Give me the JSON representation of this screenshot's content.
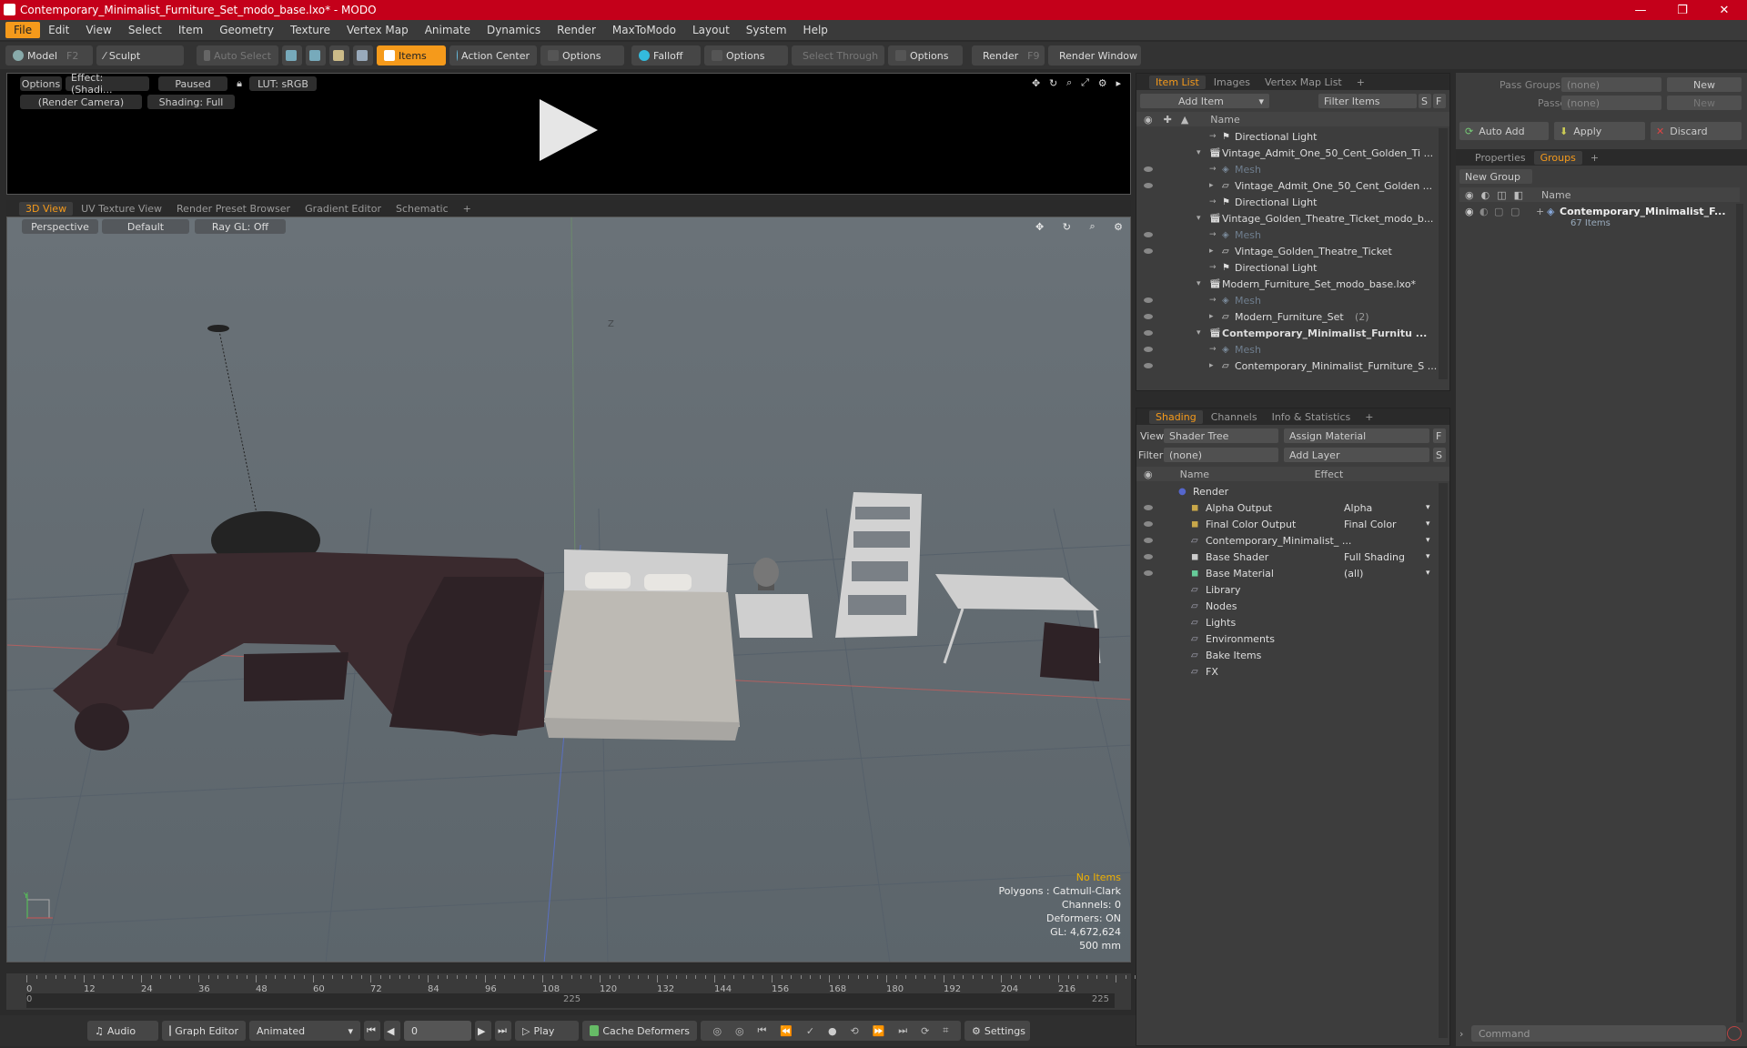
{
  "window": {
    "title": "Contemporary_Minimalist_Furniture_Set_modo_base.lxo* - MODO",
    "minimize": "—",
    "maximize": "❐",
    "close": "✕"
  },
  "menu": [
    "File",
    "Edit",
    "View",
    "Select",
    "Item",
    "Geometry",
    "Texture",
    "Vertex Map",
    "Animate",
    "Dynamics",
    "Render",
    "MaxToModo",
    "Layout",
    "System",
    "Help"
  ],
  "toolbar": {
    "model": "Model",
    "model_key": "F2",
    "sculpt": "Sculpt",
    "auto_select": "Auto Select",
    "items": "Items",
    "action_center": "Action Center",
    "options1": "Options",
    "falloff": "Falloff",
    "options2": "Options",
    "select_through": "Select Through",
    "options3": "Options",
    "render": "Render",
    "render_key": "F9",
    "render_window": "Render Window"
  },
  "preview": {
    "options": "Options",
    "effect": "Effect: (Shadi...",
    "paused": "Paused",
    "lut": "LUT: sRGB",
    "camera": "(Render Camera)",
    "shading": "Shading: Full"
  },
  "view_tabs": [
    "3D View",
    "UV Texture View",
    "Render Preset Browser",
    "Gradient Editor",
    "Schematic",
    "+"
  ],
  "viewport": {
    "perspective": "Perspective",
    "default": "Default",
    "raygl": "Ray GL: Off",
    "info": {
      "no_items": "No Items",
      "polygons": "Polygons : Catmull-Clark",
      "channels": "Channels: 0",
      "deformers": "Deformers: ON",
      "gl": "GL: 4,672,624",
      "scale": "500 mm"
    },
    "axis_z": "Z",
    "axis_y": "Y"
  },
  "timeline": {
    "ticks": [
      "0",
      "12",
      "24",
      "36",
      "48",
      "60",
      "72",
      "84",
      "96",
      "108",
      "120",
      "132",
      "144",
      "156",
      "168",
      "180",
      "192",
      "204",
      "216"
    ],
    "start": "0",
    "mid": "225",
    "end": "225"
  },
  "transport": {
    "audio": "Audio",
    "graph_editor": "Graph Editor",
    "animated": "Animated",
    "frame": "0",
    "play": "Play",
    "cache": "Cache Deformers",
    "settings": "Settings"
  },
  "item_list": {
    "tabs": [
      "Item List",
      "Images",
      "Vertex Map List",
      "+"
    ],
    "add_item": "Add Item",
    "filter_items": "Filter Items",
    "s": "S",
    "f": "F",
    "name_header": "Name",
    "rows": [
      {
        "indent": 1,
        "label": "Directional Light",
        "kind": "light"
      },
      {
        "indent": 0,
        "label": "Vintage_Admit_One_50_Cent_Golden_Ti ...",
        "kind": "scene"
      },
      {
        "indent": 1,
        "label": "Mesh",
        "kind": "mesh"
      },
      {
        "indent": 1,
        "label": "Vintage_Admit_One_50_Cent_Golden ...",
        "kind": "group"
      },
      {
        "indent": 1,
        "label": "Directional Light",
        "kind": "light"
      },
      {
        "indent": 0,
        "label": "Vintage_Golden_Theatre_Ticket_modo_b...",
        "kind": "scene"
      },
      {
        "indent": 1,
        "label": "Mesh",
        "kind": "mesh"
      },
      {
        "indent": 1,
        "label": "Vintage_Golden_Theatre_Ticket",
        "kind": "group"
      },
      {
        "indent": 1,
        "label": "Directional Light",
        "kind": "light"
      },
      {
        "indent": 0,
        "label": "Modern_Furniture_Set_modo_base.lxo*",
        "kind": "scene"
      },
      {
        "indent": 1,
        "label": "Mesh",
        "kind": "mesh"
      },
      {
        "indent": 1,
        "label": "Modern_Furniture_Set",
        "kind": "group",
        "count": "(2)"
      },
      {
        "indent": 0,
        "label": "Contemporary_Minimalist_Furnitu ...",
        "kind": "scene",
        "bold": true
      },
      {
        "indent": 1,
        "label": "Mesh",
        "kind": "mesh"
      },
      {
        "indent": 1,
        "label": "Contemporary_Minimalist_Furniture_S ...",
        "kind": "group"
      }
    ]
  },
  "shading": {
    "tabs": [
      "Shading",
      "Channels",
      "Info & Statistics",
      "+"
    ],
    "view_label": "View",
    "view_value": "Shader Tree",
    "assign_material": "Assign Material",
    "f": "F",
    "filter_label": "Filter",
    "filter_value": "(none)",
    "add_layer": "Add Layer",
    "s": "S",
    "name_header": "Name",
    "effect_header": "Effect",
    "rows": [
      {
        "label": "Render",
        "effect": "",
        "indent": 0,
        "eye": false
      },
      {
        "label": "Alpha Output",
        "effect": "Alpha",
        "indent": 1,
        "eye": true
      },
      {
        "label": "Final Color Output",
        "effect": "Final Color",
        "indent": 1,
        "eye": true
      },
      {
        "label": "Contemporary_Minimalist_ ...",
        "effect": "",
        "indent": 1,
        "eye": true
      },
      {
        "label": "Base Shader",
        "effect": "Full Shading",
        "indent": 1,
        "eye": true
      },
      {
        "label": "Base Material",
        "effect": "(all)",
        "indent": 1,
        "eye": true
      },
      {
        "label": "Library",
        "effect": "",
        "indent": 1,
        "eye": false
      },
      {
        "label": "Nodes",
        "effect": "",
        "indent": 1,
        "eye": false
      },
      {
        "label": "Lights",
        "effect": "",
        "indent": 1,
        "eye": false
      },
      {
        "label": "Environments",
        "effect": "",
        "indent": 1,
        "eye": false
      },
      {
        "label": "Bake Items",
        "effect": "",
        "indent": 1,
        "eye": false
      },
      {
        "label": "FX",
        "effect": "",
        "indent": 1,
        "eye": false
      }
    ]
  },
  "groups": {
    "pass_groups": "Pass Groups",
    "pass_groups_val": "(none)",
    "passes": "Passes",
    "passes_val": "(none)",
    "new": "New",
    "new2": "New",
    "auto_add": "Auto Add",
    "apply": "Apply",
    "discard": "Discard",
    "tabs": [
      "Properties",
      "Groups",
      "+"
    ],
    "new_group": "New Group",
    "name_header": "Name",
    "group_name": "Contemporary_Minimalist_F...",
    "group_count": "67 Items"
  },
  "command": {
    "placeholder": "Command"
  }
}
